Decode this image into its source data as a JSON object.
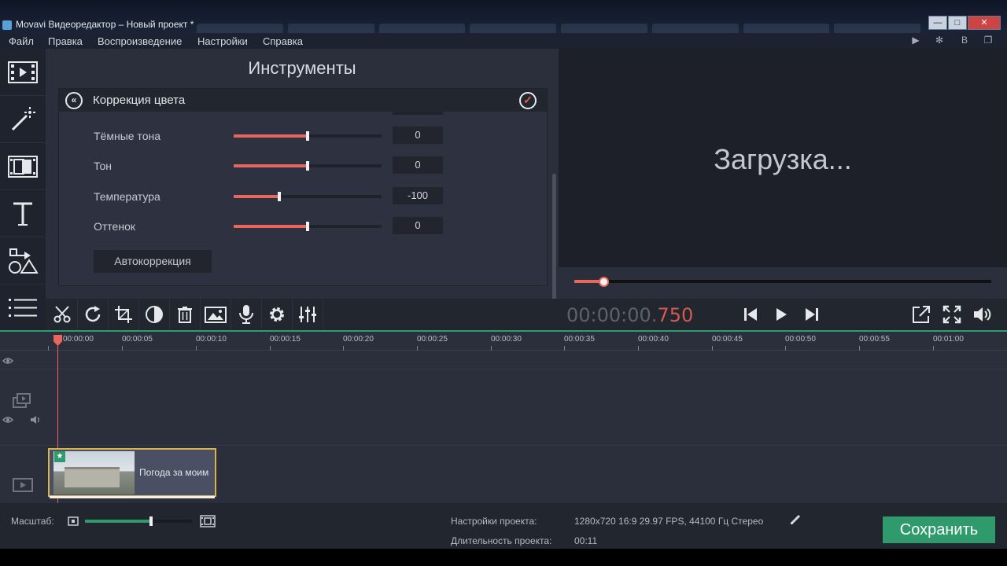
{
  "window": {
    "title": "Movavi Видеоредактор – Новый проект *",
    "controls": [
      "—",
      "□",
      "✕"
    ]
  },
  "menu": [
    "Файл",
    "Правка",
    "Воспроизведение",
    "Настройки",
    "Справка"
  ],
  "left_tools": [
    "video-clips-icon",
    "magic-wand-icon",
    "transitions-icon",
    "titles-icon",
    "shapes-icon",
    "more-tools-icon"
  ],
  "tools_panel": {
    "heading": "Инструменты",
    "color_correction": {
      "title": "Коррекция цвета",
      "rows": [
        {
          "label": "Тёмные тона",
          "value": "0",
          "level": 0.5
        },
        {
          "label": "Тон",
          "value": "0",
          "level": 0.5
        },
        {
          "label": "Температура",
          "value": "-100",
          "level": 0.31
        },
        {
          "label": "Оттенок",
          "value": "0",
          "level": 0.5
        }
      ],
      "auto_button": "Автокоррекция"
    }
  },
  "preview": {
    "status": "Загрузка...",
    "progress": 0.07,
    "timecode_main": "00:00:00.",
    "timecode_ms": "750"
  },
  "edit_toolbar": [
    "scissors-icon",
    "rotate-icon",
    "crop-icon",
    "color-adjust-icon",
    "trash-icon",
    "image-icon",
    "microphone-icon",
    "gear-icon",
    "equalizer-icon"
  ],
  "player_buttons": [
    "skip-back-icon",
    "play-icon",
    "skip-forward-icon"
  ],
  "player_right": [
    "export-icon",
    "fullscreen-icon",
    "volume-icon"
  ],
  "timeline": {
    "ticks": [
      "00:00:00",
      "00:00:05",
      "00:00:10",
      "00:00:15",
      "00:00:20",
      "00:00:25",
      "00:00:30",
      "00:00:35",
      "00:00:40",
      "00:00:45",
      "00:00:50",
      "00:00:55",
      "00:01:00"
    ],
    "clip_name": "Погода за моим"
  },
  "status": {
    "zoom_label": "Масштаб:",
    "zoom_level": 0.62,
    "project_settings_label": "Настройки проекта:",
    "project_settings_value": "1280x720 16:9 29.97 FPS, 44100 Гц Стерео",
    "duration_label": "Длительность проекта:",
    "duration_value": "00:11",
    "save_label": "Сохранить"
  },
  "colors": {
    "accent": "#e8665c",
    "green": "#2f9a6c"
  }
}
